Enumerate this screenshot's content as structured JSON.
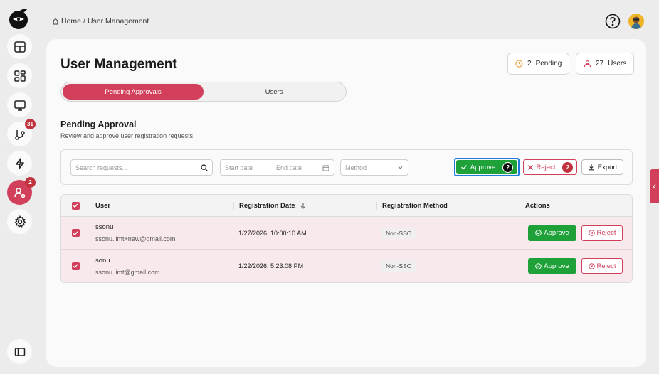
{
  "breadcrumb": {
    "home": "Home",
    "separator": "/",
    "current": "User Management"
  },
  "nav": {
    "badges": {
      "git": "31",
      "users": "2"
    }
  },
  "page": {
    "title": "User Management",
    "stats": {
      "pending_count": "2",
      "pending_label": "Pending",
      "users_count": "27",
      "users_label": "Users"
    },
    "tabs": [
      "Pending Approvals",
      "Users"
    ]
  },
  "section": {
    "title": "Pending Approval",
    "subtitle": "Review and approve user registration requests."
  },
  "toolbar": {
    "search_placeholder": "Search requests...",
    "start_date": "Start date",
    "end_date": "End date",
    "method_placeholder": "Method",
    "approve_label": "Approve",
    "approve_count": "2",
    "reject_label": "Reject",
    "reject_count": "2",
    "export_label": "Export"
  },
  "table": {
    "headers": [
      "User",
      "Registration Date",
      "Registration Method",
      "Actions"
    ],
    "rows": [
      {
        "name": "ssonu",
        "email": "ssonu.iimt+new@gmail.com",
        "date": "1/27/2026, 10:00:10 AM",
        "method": "Non-SSO",
        "approve": "Approve",
        "reject": "Reject"
      },
      {
        "name": "sonu",
        "email": "ssonu.iimt@gmail.com",
        "date": "1/22/2026, 5:23:08 PM",
        "method": "Non-SSO",
        "approve": "Approve",
        "reject": "Reject"
      }
    ]
  },
  "colors": {
    "accent": "#d23f5a",
    "approve": "#1fa13a",
    "focus": "#1f7ae0"
  }
}
